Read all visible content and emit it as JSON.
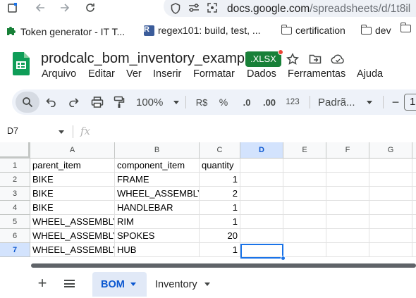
{
  "browser": {
    "url_host": "docs.google.com",
    "url_path": "/spreadsheets/d/1t8il"
  },
  "bookmarks": [
    {
      "label": "Token generator - IT T...",
      "icon": "puzzle-icon"
    },
    {
      "label": "regex101: build, test, ...",
      "icon": "regex101-icon"
    },
    {
      "label": "certification",
      "icon": "folder-icon"
    },
    {
      "label": "dev",
      "icon": "folder-icon"
    }
  ],
  "doc": {
    "title": "prodcalc_bom_inventory_example",
    "badge": ".XLSX",
    "accent": "#0f9d58"
  },
  "menu": [
    "Arquivo",
    "Editar",
    "Ver",
    "Inserir",
    "Formatar",
    "Dados",
    "Ferramentas",
    "Ajuda"
  ],
  "toolbar": {
    "zoom": "100%",
    "currency": "R$",
    "percent": "%",
    "decrease_decimal": ".0",
    "increase_decimal": ".00",
    "number_format": "123",
    "font": "Padrã...",
    "font_size": "1"
  },
  "formula_bar": {
    "cell_ref": "D7",
    "fx": "fx",
    "value": ""
  },
  "grid": {
    "columns": [
      "A",
      "B",
      "C",
      "D",
      "E",
      "F",
      "G"
    ],
    "selected_column": "D",
    "selected_row": "7",
    "rows": [
      {
        "num": "1",
        "cells": [
          "parent_item",
          "component_item",
          "quantity"
        ]
      },
      {
        "num": "2",
        "cells": [
          "BIKE",
          "FRAME",
          "1"
        ]
      },
      {
        "num": "3",
        "cells": [
          "BIKE",
          "WHEEL_ASSEMBLY",
          "2"
        ]
      },
      {
        "num": "4",
        "cells": [
          "BIKE",
          "HANDLEBAR",
          "1"
        ]
      },
      {
        "num": "5",
        "cells": [
          "WHEEL_ASSEMBLY",
          "RIM",
          "1"
        ]
      },
      {
        "num": "6",
        "cells": [
          "WHEEL_ASSEMBLY",
          "SPOKES",
          "20"
        ]
      },
      {
        "num": "7",
        "cells": [
          "WHEEL_ASSEMBLY",
          "HUB",
          "1"
        ]
      }
    ]
  },
  "sheets": {
    "tabs": [
      "BOM",
      "Inventory"
    ],
    "active": "BOM"
  }
}
